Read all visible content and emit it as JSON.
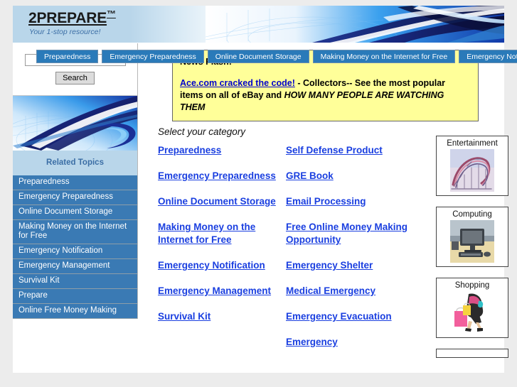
{
  "site": {
    "brand_name": "2PREPARE",
    "brand_tm": "™",
    "tagline": "Your 1-stop resource!"
  },
  "nav": {
    "tabs": [
      {
        "label": "Preparedness"
      },
      {
        "label": "Emergency Preparedness"
      },
      {
        "label": "Online Document Storage"
      },
      {
        "label": "Making Money on the Internet for Free"
      },
      {
        "label": "Emergency Notification"
      }
    ]
  },
  "search": {
    "value": "",
    "placeholder": "",
    "button_label": "Search"
  },
  "sidebar": {
    "related_topics_header": "Related Topics",
    "items": [
      {
        "label": "Preparedness"
      },
      {
        "label": "Emergency Preparedness"
      },
      {
        "label": "Online Document Storage"
      },
      {
        "label": "Making Money on the Internet for Free"
      },
      {
        "label": "Emergency Notification"
      },
      {
        "label": "Emergency Management"
      },
      {
        "label": "Survival Kit"
      },
      {
        "label": "Prepare"
      },
      {
        "label": "Online Free Money Making"
      }
    ]
  },
  "news_flash": {
    "title": "News Flash:",
    "link_text": "Ace.com cracked the code!",
    "body_before": " - Collectors-- See the most popular items on all of eBay and ",
    "body_caps": "HOW MANY PEOPLE ARE WATCHING THEM"
  },
  "main": {
    "select_category_label": "Select your category",
    "categories_left": [
      {
        "label": "Preparedness"
      },
      {
        "label": "Emergency Preparedness"
      },
      {
        "label": "Online Document Storage"
      },
      {
        "label": "Making Money on the Internet for Free"
      },
      {
        "label": "Emergency Notification"
      },
      {
        "label": "Emergency Management"
      },
      {
        "label": "Survival Kit"
      }
    ],
    "categories_right": [
      {
        "label": "Self Defense Product"
      },
      {
        "label": "GRE Book"
      },
      {
        "label": "Email Processing"
      },
      {
        "label": "Free Online Money Making Opportunity"
      },
      {
        "label": "Emergency Shelter"
      },
      {
        "label": "Medical Emergency"
      },
      {
        "label": "Emergency Evacuation"
      },
      {
        "label": "Emergency"
      }
    ]
  },
  "boxes": [
    {
      "label": "Entertainment",
      "icon": "rollercoaster-image"
    },
    {
      "label": "Computing",
      "icon": "desktop-computer-image"
    },
    {
      "label": "Shopping",
      "icon": "shopper-image"
    },
    {
      "label": "",
      "icon": ""
    }
  ],
  "colors": {
    "header_blue": "#b9d6ea",
    "nav_tab_blue": "#2a7ab9",
    "sidebar_item_blue": "#3a7ab4",
    "link_blue": "#1a3fe0",
    "newsflash_yellow": "#ffff99",
    "page_background": "#ececec"
  }
}
